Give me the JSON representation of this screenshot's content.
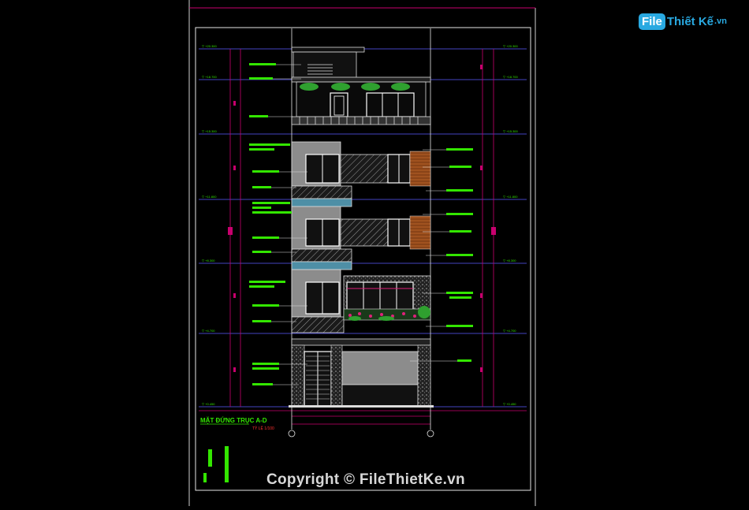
{
  "drawing": {
    "title": "MẶT ĐỨNG TRỤC A-D",
    "scale": "TỶ LỆ 1/100"
  },
  "watermark": {
    "text": "Copyright © FileThietKe.vn"
  },
  "logo": {
    "box": "File",
    "name": "Thiết Kế",
    "suffix": ".vn"
  },
  "colors": {
    "background": "#000000",
    "frame": "#ffffff",
    "level_line": "#5a5aff",
    "dimension": "#c8006e",
    "annotation": "#33e600",
    "hatch": "#bfbfbf",
    "wood": "#b0602a",
    "plant": "#2fa02f",
    "flower": "#e0207a"
  }
}
